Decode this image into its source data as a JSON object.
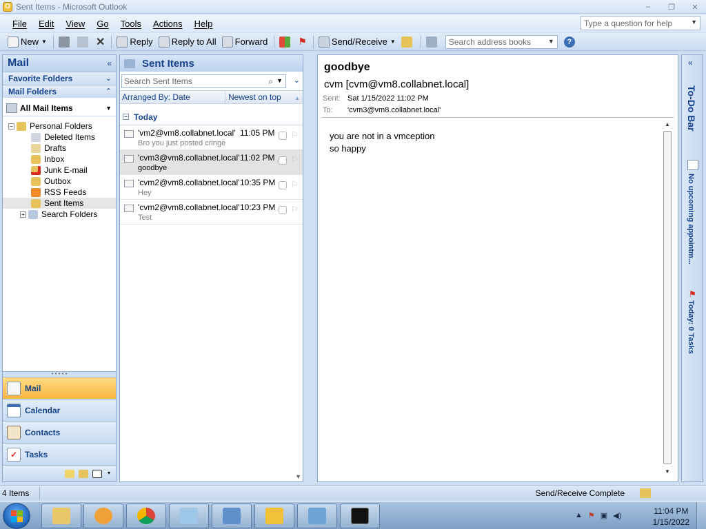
{
  "window": {
    "title": "Sent Items - Microsoft Outlook",
    "controls": [
      "–",
      "❐",
      "✕"
    ]
  },
  "menu": {
    "items": [
      "File",
      "Edit",
      "View",
      "Go",
      "Tools",
      "Actions",
      "Help"
    ],
    "help_placeholder": "Type a question for help"
  },
  "toolbar": {
    "new": "New",
    "reply": "Reply",
    "reply_all": "Reply to All",
    "forward": "Forward",
    "send_receive": "Send/Receive",
    "address_placeholder": "Search address books"
  },
  "nav": {
    "title": "Mail",
    "favorite_folders": "Favorite Folders",
    "mail_folders": "Mail Folders",
    "all_mail_items": "All Mail Items",
    "tree": {
      "root": "Personal Folders",
      "folders": [
        "Deleted Items",
        "Drafts",
        "Inbox",
        "Junk E-mail",
        "Outbox",
        "RSS Feeds",
        "Sent Items"
      ],
      "search": "Search Folders"
    },
    "buttons": [
      "Mail",
      "Calendar",
      "Contacts",
      "Tasks"
    ]
  },
  "list": {
    "title": "Sent Items",
    "search_placeholder": "Search Sent Items",
    "arranged_by": "Arranged By: Date",
    "sort": "Newest on top",
    "group": "Today",
    "messages": [
      {
        "to": "'vm2@vm8.collabnet.local'",
        "time": "11:05 PM",
        "subject": "Bro you just posted cringe"
      },
      {
        "to": "'cvm3@vm8.collabnet.local'",
        "time": "11:02 PM",
        "subject": "goodbye"
      },
      {
        "to": "'cvm2@vm8.collabnet.local'",
        "time": "10:35 PM",
        "subject": "Hey"
      },
      {
        "to": "'cvm2@vm8.collabnet.local'",
        "time": "10:23 PM",
        "subject": "Test"
      }
    ]
  },
  "reading": {
    "subject": "goodbye",
    "from": "cvm [cvm@vm8.collabnet.local]",
    "sent_label": "Sent:",
    "sent_value": "Sat 1/15/2022 11:02 PM",
    "to_label": "To:",
    "to_value": "'cvm3@vm8.collabnet.local'",
    "body": [
      "you are not in a vmception",
      "so happy"
    ]
  },
  "todo": {
    "title": "To-Do Bar",
    "appointments": "No upcoming appointm...",
    "tasks": "Today: 0 Tasks"
  },
  "status": {
    "count": "4 Items",
    "sync": "Send/Receive Complete"
  },
  "taskbar": {
    "time": "11:04 PM",
    "date": "1/15/2022"
  },
  "colors": {
    "accent": "#15428b",
    "active_nav": "#fbb543",
    "chrome": "#c9dbf1"
  }
}
